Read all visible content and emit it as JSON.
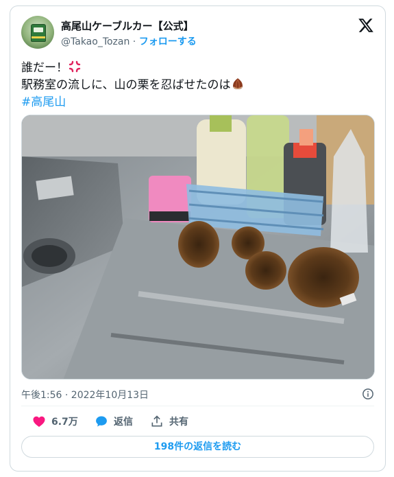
{
  "author": {
    "display_name": "高尾山ケーブルカー【公式】",
    "handle": "@Takao_Tozan",
    "separator": " · ",
    "follow_label": "フォローする",
    "avatar_icon": "cable-car-avatar"
  },
  "brand": {
    "logo_icon": "x-logo-icon"
  },
  "tweet": {
    "line1": "誰だー！",
    "line1_emoji": "anger-symbol-emoji",
    "line2": "駅務室の流しに、山の栗を忍ばせたのは",
    "line2_emoji": "chestnut-emoji",
    "hashtag": "#高尾山"
  },
  "media": {
    "description_icon": "photo-sink-with-chestnut-burrs"
  },
  "meta": {
    "timestamp": "午後1:56 · 2022年10月13日",
    "info_icon": "info-icon"
  },
  "actions": {
    "like_count": "6.7万",
    "reply_label": "返信",
    "share_label": "共有"
  },
  "read_replies_label": "198件の返信を読む",
  "colors": {
    "accent": "#1d9bf0",
    "like": "#f91880",
    "text": "#0f1419",
    "secondary": "#536471",
    "border": "#cfd9de"
  }
}
